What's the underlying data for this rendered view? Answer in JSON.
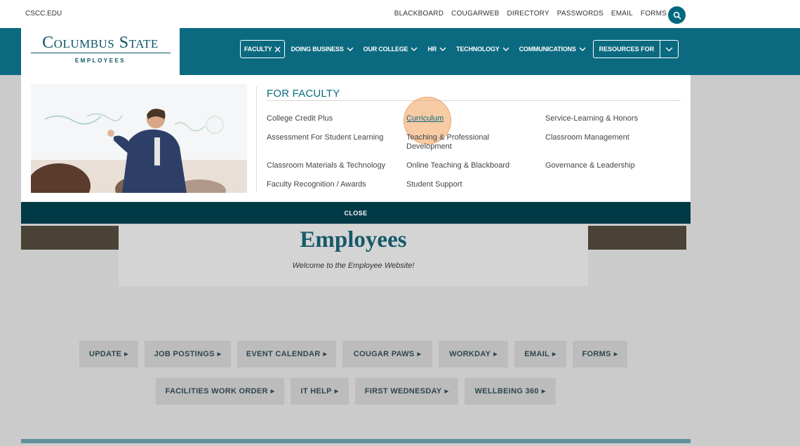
{
  "utility": {
    "site_link": "CSCC.EDU",
    "links": [
      "BLACKBOARD",
      "COUGARWEB",
      "DIRECTORY",
      "PASSWORDS",
      "EMAIL",
      "FORMS"
    ],
    "search_icon": "search-icon"
  },
  "logo": {
    "title": "Columbus State",
    "subtitle": "EMPLOYEES"
  },
  "nav": {
    "items": [
      "FACULTY",
      "DOING BUSINESS",
      "OUR COLLEGE",
      "HR",
      "TECHNOLOGY",
      "COMMUNICATIONS"
    ],
    "resources_label": "RESOURCES FOR"
  },
  "mega_menu": {
    "heading": "FOR FACULTY",
    "columns": [
      [
        "College Credit Plus",
        "Assessment For Student Learning",
        "Classroom Materials & Technology",
        "Faculty Recognition / Awards"
      ],
      [
        "Curriculum",
        "Teaching & Professional Development",
        "Online Teaching & Blackboard",
        "Student Support"
      ],
      [
        "Service-Learning & Honors",
        "Classroom Management",
        "Governance & Leadership"
      ]
    ],
    "close_label": "CLOSE"
  },
  "hero": {
    "title": "Employees",
    "subtitle": "Welcome to the Employee Website!"
  },
  "quick_links": {
    "row1": [
      "UPDATE",
      "JOB POSTINGS",
      "EVENT CALENDAR",
      "COUGAR PAWS",
      "WORKDAY",
      "EMAIL",
      "FORMS"
    ],
    "row2": [
      "FACILITIES WORK ORDER",
      "IT HELP",
      "FIRST WEDNESDAY",
      "WELLBEING 360"
    ]
  },
  "colors": {
    "brand_teal": "#0b6a80",
    "dark_teal": "#003a47",
    "highlight": "#f0a05a"
  }
}
